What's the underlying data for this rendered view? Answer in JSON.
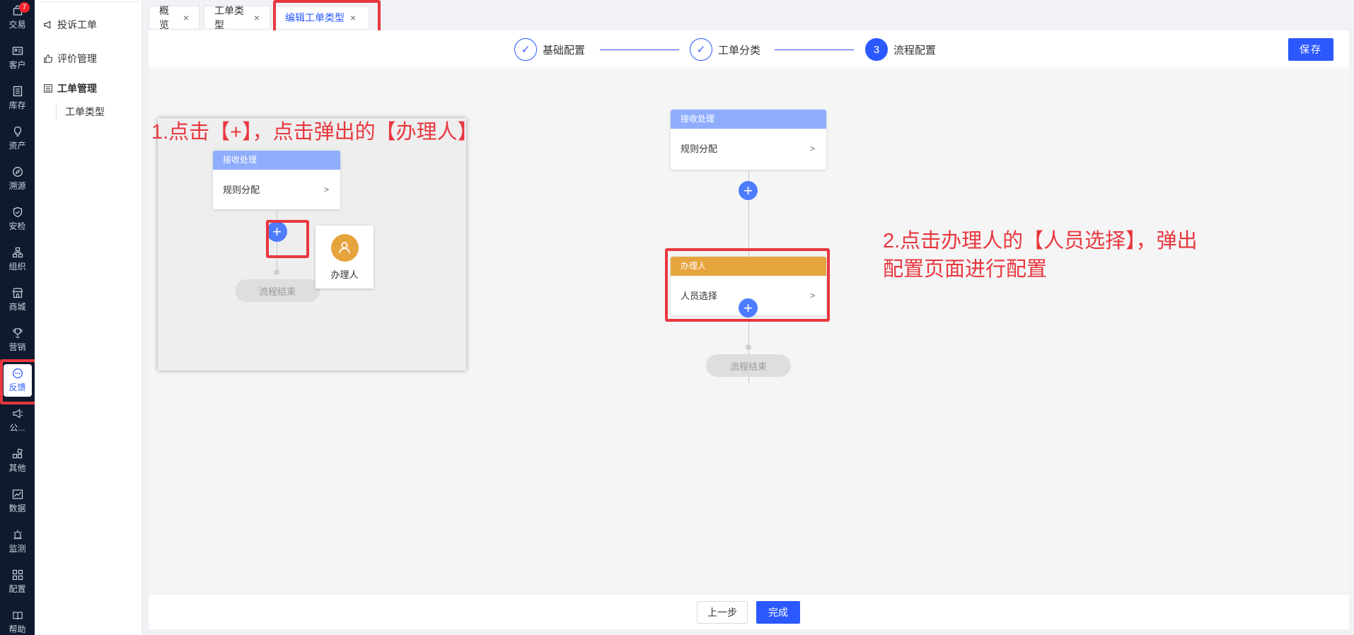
{
  "nav": {
    "items": [
      {
        "label": "交易",
        "icon": "shopping-bag-icon",
        "badge": "7"
      },
      {
        "label": "客户",
        "icon": "id-card-icon"
      },
      {
        "label": "库存",
        "icon": "list-icon"
      },
      {
        "label": "资产",
        "icon": "lightbulb-icon"
      },
      {
        "label": "溯源",
        "icon": "compass-icon"
      },
      {
        "label": "安检",
        "icon": "shield-check-icon"
      },
      {
        "label": "组织",
        "icon": "org-tree-icon"
      },
      {
        "label": "商城",
        "icon": "store-icon"
      },
      {
        "label": "营销",
        "icon": "trophy-icon"
      },
      {
        "label": "反馈",
        "icon": "chat-bubble-icon"
      },
      {
        "label": "公...",
        "icon": "megaphone-icon"
      },
      {
        "label": "其他",
        "icon": "apps-icon"
      },
      {
        "label": "数据",
        "icon": "line-chart-icon"
      },
      {
        "label": "监测",
        "icon": "alarm-icon"
      },
      {
        "label": "配置",
        "icon": "grid-icon"
      },
      {
        "label": "帮助",
        "icon": "book-icon"
      }
    ]
  },
  "sidebar": {
    "complaint": "投诉工单",
    "evaluation": "评价管理",
    "ticket_mgmt": "工单管理",
    "ticket_type": "工单类型"
  },
  "tabs": [
    {
      "label": "概览",
      "close": "×"
    },
    {
      "label": "工单类型",
      "close": "×"
    },
    {
      "label": "编辑工单类型",
      "close": "×"
    }
  ],
  "steps": {
    "step1": {
      "label": "基础配置",
      "mark": "✓"
    },
    "step2": {
      "label": "工单分类",
      "mark": "✓"
    },
    "step3": {
      "label": "流程配置",
      "mark": "3"
    },
    "save": "保存"
  },
  "inset": {
    "card_header": "接收处理",
    "card_body": "规则分配",
    "arrow": ">",
    "plus": "+",
    "popup_label": "办理人",
    "end": "流程结束"
  },
  "flow": {
    "card1_header": "接收处理",
    "card1_body": "规则分配",
    "card2_header": "办理人",
    "card2_body": "人员选择",
    "arrow": ">",
    "plus": "+",
    "end": "流程结束"
  },
  "annotations": {
    "note1": "1.点击【+】，点击弹出的【办理人】",
    "note2_line1": "2.点击办理人的【人员选择】，弹出",
    "note2_line2": "配置页面进行配置"
  },
  "footer": {
    "prev": "上一步",
    "finish": "完成"
  },
  "colors": {
    "primary": "#2b59ff",
    "annotation_red": "#e8373f",
    "receive_header": "#8fadfd",
    "handler_header": "#e6a43d",
    "nav_bg": "#0f1a2e"
  }
}
